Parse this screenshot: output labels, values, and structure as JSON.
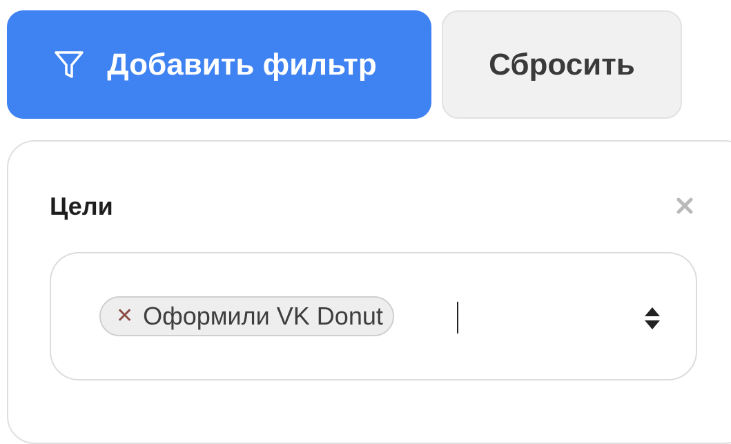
{
  "actions": {
    "add_filter_label": "Добавить фильтр",
    "add_filter_icon": "filter-funnel-icon",
    "reset_label": "Сбросить"
  },
  "filter_panel": {
    "title": "Цели",
    "close_icon": "close-icon",
    "select": {
      "selected_tags": [
        {
          "label": "Оформили VK Donut",
          "remove_icon": "tag-remove-icon"
        }
      ],
      "input_value": "",
      "toggle_icon": "select-arrows-icon"
    }
  },
  "colors": {
    "primary": "#3f82f1",
    "secondary_bg": "#f1f1f1",
    "tag_bg": "#eeeeee",
    "tag_remove": "#8a4c44"
  }
}
